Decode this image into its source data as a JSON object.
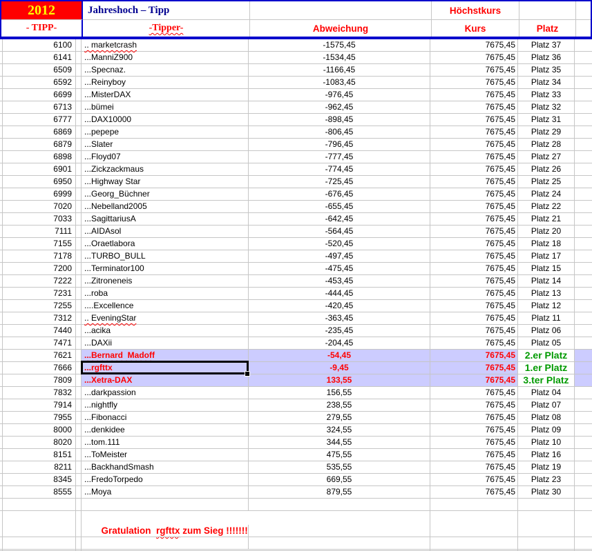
{
  "header": {
    "year": "2012",
    "title": "Jahreshoch – Tipp",
    "hoechstkurs": "Höchstkurs"
  },
  "columns": {
    "tipp": "- TIPP-",
    "tipper": "-Tipper-",
    "abweichung": "Abweichung",
    "kurs": "Kurs",
    "platz": "Platz"
  },
  "colors": {
    "header_bg": "#ff0000",
    "year_text": "#ffff00",
    "title_text": "#000090",
    "accent_red": "#ff0000",
    "highlight_bg": "#ccccff",
    "winner_green": "#009a00",
    "border_blue": "#0000cc",
    "gridline": "#c6c6c6"
  },
  "rows": [
    {
      "tipp": "6100",
      "tipper": ".. marketcrash",
      "abw": "-1575,45",
      "kurs": "7675,45",
      "platz": "Platz 37",
      "squiggle": true
    },
    {
      "tipp": "6141",
      "tipper": "...ManniZ900",
      "abw": "-1534,45",
      "kurs": "7675,45",
      "platz": "Platz 36"
    },
    {
      "tipp": "6509",
      "tipper": "...Specnaz.",
      "abw": "-1166,45",
      "kurs": "7675,45",
      "platz": "Platz 35"
    },
    {
      "tipp": "6592",
      "tipper": "...Reinyboy",
      "abw": "-1083,45",
      "kurs": "7675,45",
      "platz": "Platz 34"
    },
    {
      "tipp": "6699",
      "tipper": "...MisterDAX",
      "abw": "-976,45",
      "kurs": "7675,45",
      "platz": "Platz 33"
    },
    {
      "tipp": "6713",
      "tipper": "...bümei",
      "abw": "-962,45",
      "kurs": "7675,45",
      "platz": "Platz 32"
    },
    {
      "tipp": "6777",
      "tipper": "...DAX10000",
      "abw": "-898,45",
      "kurs": "7675,45",
      "platz": "Platz 31"
    },
    {
      "tipp": "6869",
      "tipper": "...pepepe",
      "abw": "-806,45",
      "kurs": "7675,45",
      "platz": "Platz 29"
    },
    {
      "tipp": "6879",
      "tipper": "...Slater",
      "abw": "-796,45",
      "kurs": "7675,45",
      "platz": "Platz 28"
    },
    {
      "tipp": "6898",
      "tipper": "...Floyd07",
      "abw": "-777,45",
      "kurs": "7675,45",
      "platz": "Platz 27"
    },
    {
      "tipp": "6901",
      "tipper": "...Zickzackmaus",
      "abw": "-774,45",
      "kurs": "7675,45",
      "platz": "Platz 26"
    },
    {
      "tipp": "6950",
      "tipper": "...Highway Star",
      "abw": "-725,45",
      "kurs": "7675,45",
      "platz": "Platz 25"
    },
    {
      "tipp": "6999",
      "tipper": "...Georg_Büchner",
      "abw": "-676,45",
      "kurs": "7675,45",
      "platz": "Platz 24"
    },
    {
      "tipp": "7020",
      "tipper": "...Nebelland2005",
      "abw": "-655,45",
      "kurs": "7675,45",
      "platz": "Platz 22"
    },
    {
      "tipp": "7033",
      "tipper": "...SagittariusA",
      "abw": "-642,45",
      "kurs": "7675,45",
      "platz": "Platz 21"
    },
    {
      "tipp": "7111",
      "tipper": "...AIDAsol",
      "abw": "-564,45",
      "kurs": "7675,45",
      "platz": "Platz 20"
    },
    {
      "tipp": "7155",
      "tipper": "...Oraetlabora",
      "abw": "-520,45",
      "kurs": "7675,45",
      "platz": "Platz 18"
    },
    {
      "tipp": "7178",
      "tipper": "...TURBO_BULL",
      "abw": "-497,45",
      "kurs": "7675,45",
      "platz": "Platz 17"
    },
    {
      "tipp": "7200",
      "tipper": "...Terminator100",
      "abw": "-475,45",
      "kurs": "7675,45",
      "platz": "Platz 15"
    },
    {
      "tipp": "7222",
      "tipper": "...Zitroneneis",
      "abw": "-453,45",
      "kurs": "7675,45",
      "platz": "Platz 14"
    },
    {
      "tipp": "7231",
      "tipper": "...roba",
      "abw": "-444,45",
      "kurs": "7675,45",
      "platz": "Platz 13"
    },
    {
      "tipp": "7255",
      "tipper": "....Excellence",
      "abw": "-420,45",
      "kurs": "7675,45",
      "platz": "Platz 12"
    },
    {
      "tipp": "7312",
      "tipper": ".. EveningStar",
      "abw": "-363,45",
      "kurs": "7675,45",
      "platz": "Platz 11",
      "squiggle": true
    },
    {
      "tipp": "7440",
      "tipper": "...acika",
      "abw": "-235,45",
      "kurs": "7675,45",
      "platz": "Platz 06"
    },
    {
      "tipp": "7471",
      "tipper": "...DAXii",
      "abw": "-204,45",
      "kurs": "7675,45",
      "platz": "Platz 05"
    },
    {
      "tipp": "7621",
      "tipper": "...Bernard  Madoff",
      "abw": "-54,45",
      "kurs": "7675,45",
      "platz": "2.er Platz",
      "highlight": true,
      "green": true,
      "squiggle": true
    },
    {
      "tipp": "7666",
      "tipper": "...rgfttx",
      "abw": "-9,45",
      "kurs": "7675,45",
      "platz": "1.er Platz",
      "highlight": true,
      "green": true,
      "squiggle": true,
      "selected": true
    },
    {
      "tipp": "7809",
      "tipper": "...Xetra-DAX",
      "abw": "133,55",
      "kurs": "7675,45",
      "platz": "3.ter Platz",
      "highlight": true,
      "green": true
    },
    {
      "tipp": "7832",
      "tipper": "...darkpassion",
      "abw": "156,55",
      "kurs": "7675,45",
      "platz": "Platz 04"
    },
    {
      "tipp": "7914",
      "tipper": "...nightfly",
      "abw": "238,55",
      "kurs": "7675,45",
      "platz": "Platz 07"
    },
    {
      "tipp": "7955",
      "tipper": "...Fibonacci",
      "abw": "279,55",
      "kurs": "7675,45",
      "platz": "Platz 08"
    },
    {
      "tipp": "8000",
      "tipper": "...denkidee",
      "abw": "324,55",
      "kurs": "7675,45",
      "platz": "Platz 09"
    },
    {
      "tipp": "8020",
      "tipper": "...tom.111",
      "abw": "344,55",
      "kurs": "7675,45",
      "platz": "Platz 10"
    },
    {
      "tipp": "8151",
      "tipper": "...ToMeister",
      "abw": "475,55",
      "kurs": "7675,45",
      "platz": "Platz 16"
    },
    {
      "tipp": "8211",
      "tipper": "...BackhandSmash",
      "abw": "535,55",
      "kurs": "7675,45",
      "platz": "Platz 19"
    },
    {
      "tipp": "8345",
      "tipper": "...FredoTorpedo",
      "abw": "669,55",
      "kurs": "7675,45",
      "platz": "Platz 23"
    },
    {
      "tipp": "8555",
      "tipper": "...Moya",
      "abw": "879,55",
      "kurs": "7675,45",
      "platz": "Platz 30"
    }
  ],
  "footer": {
    "message_prefix": "Gratulation  ",
    "message_name": "rgfttx",
    "message_suffix": " zum Sieg !!!!!!!"
  }
}
